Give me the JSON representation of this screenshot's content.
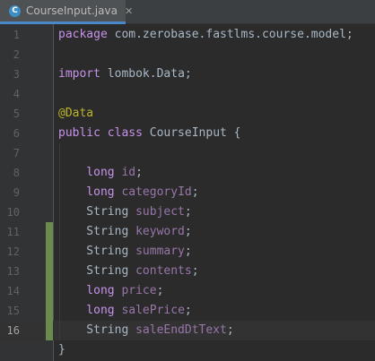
{
  "tab": {
    "icon_letter": "C",
    "title": "CourseInput.java",
    "close_glyph": "✕"
  },
  "lines": [
    {
      "number": "1",
      "tokens": [
        {
          "text": "package ",
          "cls": "kw-purple"
        },
        {
          "text": "com.zerobase.fastlms.course.model",
          "cls": "pkg"
        },
        {
          "text": ";",
          "cls": "pkg"
        }
      ]
    },
    {
      "number": "2",
      "tokens": []
    },
    {
      "number": "3",
      "tokens": [
        {
          "text": "import ",
          "cls": "kw-purple"
        },
        {
          "text": "lombok.Data",
          "cls": "pkg"
        },
        {
          "text": ";",
          "cls": "pkg"
        }
      ]
    },
    {
      "number": "4",
      "tokens": []
    },
    {
      "number": "5",
      "tokens": [
        {
          "text": "@Data",
          "cls": "ann"
        }
      ]
    },
    {
      "number": "6",
      "tokens": [
        {
          "text": "public class ",
          "cls": "kw-purple"
        },
        {
          "text": "CourseInput {",
          "cls": "type"
        }
      ]
    },
    {
      "number": "7",
      "tokens": []
    },
    {
      "number": "8",
      "tokens": [
        {
          "text": "    long ",
          "cls": "kw-purple"
        },
        {
          "text": "id",
          "cls": "field"
        },
        {
          "text": ";",
          "cls": "type"
        }
      ]
    },
    {
      "number": "9",
      "tokens": [
        {
          "text": "    long ",
          "cls": "kw-purple"
        },
        {
          "text": "categoryId",
          "cls": "field"
        },
        {
          "text": ";",
          "cls": "type"
        }
      ]
    },
    {
      "number": "10",
      "tokens": [
        {
          "text": "    String ",
          "cls": "type"
        },
        {
          "text": "subject",
          "cls": "field"
        },
        {
          "text": ";",
          "cls": "type"
        }
      ]
    },
    {
      "number": "11",
      "tokens": [
        {
          "text": "    String ",
          "cls": "type"
        },
        {
          "text": "keyword",
          "cls": "field"
        },
        {
          "text": ";",
          "cls": "type"
        }
      ]
    },
    {
      "number": "12",
      "tokens": [
        {
          "text": "    String ",
          "cls": "type"
        },
        {
          "text": "summary",
          "cls": "field"
        },
        {
          "text": ";",
          "cls": "type"
        }
      ]
    },
    {
      "number": "13",
      "tokens": [
        {
          "text": "    String ",
          "cls": "type"
        },
        {
          "text": "contents",
          "cls": "field"
        },
        {
          "text": ";",
          "cls": "type"
        }
      ]
    },
    {
      "number": "14",
      "tokens": [
        {
          "text": "    long ",
          "cls": "kw-purple"
        },
        {
          "text": "price",
          "cls": "field"
        },
        {
          "text": ";",
          "cls": "type"
        }
      ]
    },
    {
      "number": "15",
      "tokens": [
        {
          "text": "    long ",
          "cls": "kw-purple"
        },
        {
          "text": "salePrice",
          "cls": "field"
        },
        {
          "text": ";",
          "cls": "type"
        }
      ]
    },
    {
      "number": "16",
      "tokens": [
        {
          "text": "    String ",
          "cls": "type"
        },
        {
          "text": "saleEndDtText",
          "cls": "field"
        },
        {
          "text": ";",
          "cls": "type"
        }
      ]
    },
    {
      "number": "",
      "tokens": [
        {
          "text": "}",
          "cls": "type"
        }
      ]
    }
  ],
  "modified_lines": [
    "11",
    "12",
    "13",
    "14",
    "15",
    "16"
  ],
  "current_line": "16",
  "colors": {
    "background": "#2b2b2b",
    "gutter": "#313335",
    "keyword": "#c792ea",
    "field": "#9876aa",
    "annotation": "#bbb529",
    "text": "#a9b7c6",
    "vcs_added": "#6a8b4e",
    "tab_accent": "#4a88c7"
  }
}
